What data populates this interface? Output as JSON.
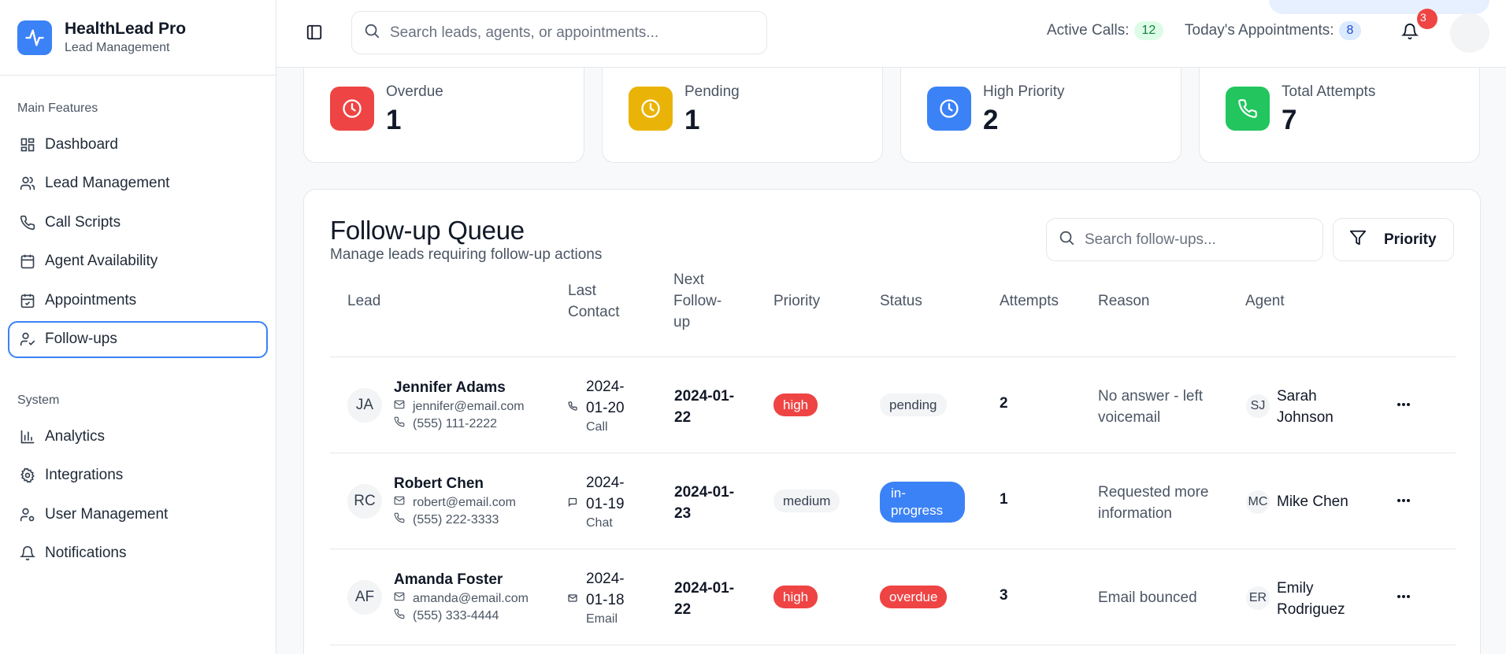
{
  "brand": {
    "title": "HealthLead Pro",
    "subtitle": "Lead Management"
  },
  "sidebar": {
    "main_heading": "Main Features",
    "main_items": [
      {
        "label": "Dashboard",
        "icon": "dashboard-icon"
      },
      {
        "label": "Lead Management",
        "icon": "users-icon"
      },
      {
        "label": "Call Scripts",
        "icon": "phone-icon"
      },
      {
        "label": "Agent Availability",
        "icon": "calendar-icon"
      },
      {
        "label": "Appointments",
        "icon": "calendar-check-icon"
      },
      {
        "label": "Follow-ups",
        "icon": "user-check-icon",
        "active": true
      }
    ],
    "system_heading": "System",
    "system_items": [
      {
        "label": "Analytics",
        "icon": "bar-chart-icon"
      },
      {
        "label": "Integrations",
        "icon": "gear-icon"
      },
      {
        "label": "User Management",
        "icon": "user-cog-icon"
      },
      {
        "label": "Notifications",
        "icon": "bell-icon"
      }
    ]
  },
  "topbar": {
    "search_placeholder": "Search leads, agents, or appointments...",
    "active_calls_label": "Active Calls:",
    "active_calls_value": "12",
    "appointments_label": "Today's Appointments:",
    "appointments_value": "8",
    "notifications_count": "3"
  },
  "stats": [
    {
      "label": "Overdue",
      "value": "1",
      "color": "#ef4444",
      "icon": "clock-icon"
    },
    {
      "label": "Pending",
      "value": "1",
      "color": "#eab308",
      "icon": "clock-icon"
    },
    {
      "label": "High Priority",
      "value": "2",
      "color": "#3b82f6",
      "icon": "clock-icon"
    },
    {
      "label": "Total Attempts",
      "value": "7",
      "color": "#22c55e",
      "icon": "phone-icon"
    }
  ],
  "queue": {
    "title": "Follow-up Queue",
    "subtitle": "Manage leads requiring follow-up actions",
    "search_placeholder": "Search follow-ups...",
    "filter_label": "Priority",
    "headers": {
      "lead": "Lead",
      "last_contact": "Last Contact",
      "next_followup": "Next Follow-up",
      "priority": "Priority",
      "status": "Status",
      "attempts": "Attempts",
      "reason": "Reason",
      "agent": "Agent"
    },
    "rows": [
      {
        "initials": "JA",
        "name": "Jennifer Adams",
        "email": "jennifer@email.com",
        "phone": "(555) 111-2222",
        "last_contact_date": "2024-01-20",
        "last_contact_type": "Call",
        "last_contact_icon": "phone-icon",
        "next_followup": "2024-01-22",
        "priority": "high",
        "status": "pending",
        "attempts": "2",
        "reason": "No answer - left voicemail",
        "agent_initials": "SJ",
        "agent": "Sarah Johnson"
      },
      {
        "initials": "RC",
        "name": "Robert Chen",
        "email": "robert@email.com",
        "phone": "(555) 222-3333",
        "last_contact_date": "2024-01-19",
        "last_contact_type": "Chat",
        "last_contact_icon": "chat-icon",
        "next_followup": "2024-01-23",
        "priority": "medium",
        "status": "in-progress",
        "attempts": "1",
        "reason": "Requested more information",
        "agent_initials": "MC",
        "agent": "Mike Chen"
      },
      {
        "initials": "AF",
        "name": "Amanda Foster",
        "email": "amanda@email.com",
        "phone": "(555) 333-4444",
        "last_contact_date": "2024-01-18",
        "last_contact_type": "Email",
        "last_contact_icon": "mail-icon",
        "next_followup": "2024-01-22",
        "priority": "high",
        "status": "overdue",
        "attempts": "3",
        "reason": "Email bounced",
        "agent_initials": "ER",
        "agent": "Emily Rodriguez"
      }
    ]
  }
}
